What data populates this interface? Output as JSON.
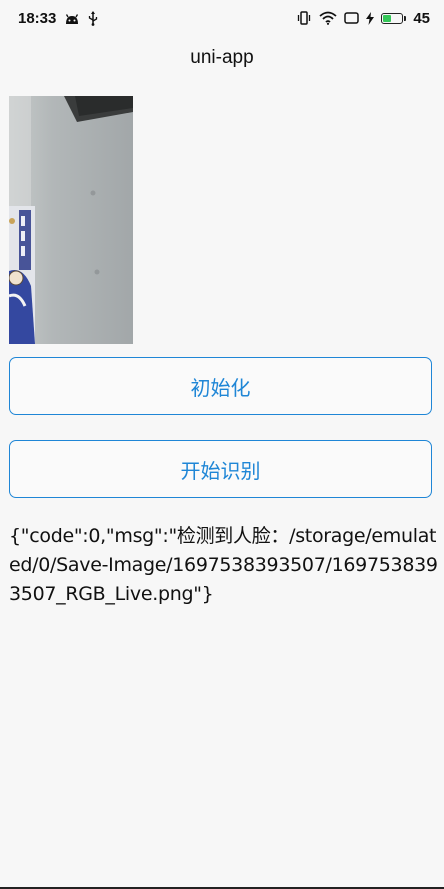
{
  "status_bar": {
    "time": "18:33",
    "battery_level": "45",
    "battery_fraction": 0.45,
    "icons": [
      "android-icon",
      "usb-icon",
      "vibrate-icon",
      "wifi-icon",
      "screen-icon",
      "charging-icon",
      "battery-icon"
    ]
  },
  "nav": {
    "title": "uni-app"
  },
  "buttons": {
    "init_label": "初始化",
    "start_label": "开始识别"
  },
  "result": {
    "text": "{\"code\":0,\"msg\":\"检测到人脸：/storage/emulated/0/Save-Image/1697538393507/1697538393507_RGB_Live.png\"}"
  },
  "colors": {
    "accent": "#1f86d6",
    "background": "#f7f7f7",
    "battery": "#35c759"
  }
}
